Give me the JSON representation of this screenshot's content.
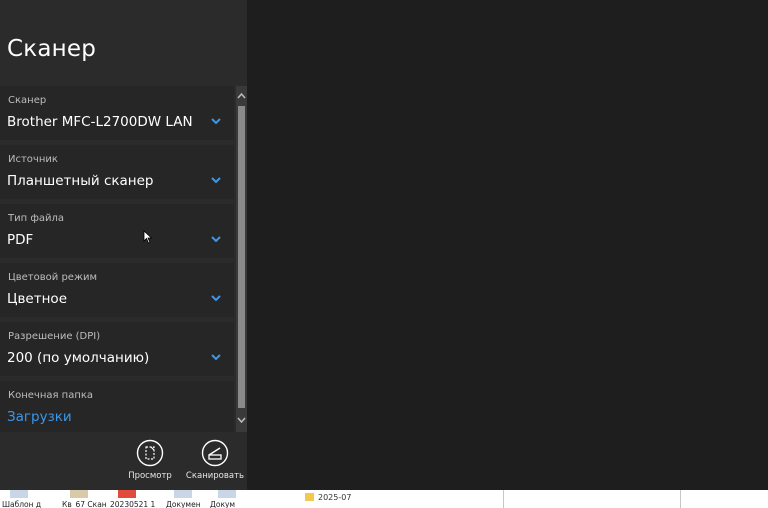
{
  "app": {
    "title": "Сканер"
  },
  "settings": [
    {
      "label": "Сканер",
      "value": "Brother MFC-L2700DW LAN",
      "is_link": false
    },
    {
      "label": "Источник",
      "value": "Планшетный сканер",
      "is_link": false
    },
    {
      "label": "Тип файла",
      "value": "PDF",
      "is_link": false
    },
    {
      "label": "Цветовой режим",
      "value": "Цветное",
      "is_link": false
    },
    {
      "label": "Разрешение (DPI)",
      "value": "200 (по умолчанию)",
      "is_link": false
    },
    {
      "label": "Конечная папка",
      "value": "Загрузки",
      "is_link": true
    }
  ],
  "actions": {
    "preview_label": "Просмотр",
    "scan_label": "Сканировать"
  },
  "taskbar": {
    "items": [
      "Шаблон д",
      "Кв_67 Скан",
      "20230521 1",
      "Докумен",
      "Докум"
    ],
    "folder_label": "2025-07"
  },
  "colors": {
    "panel_bg": "#2b2b2b",
    "setting_bg": "#262626",
    "preview_bg": "#1e1e1e",
    "accent": "#3d96e8",
    "label_text": "#bdbdbd"
  },
  "icons": {
    "dropdown": "chevron-down-icon",
    "preview": "preview-icon",
    "scan": "scan-icon"
  }
}
